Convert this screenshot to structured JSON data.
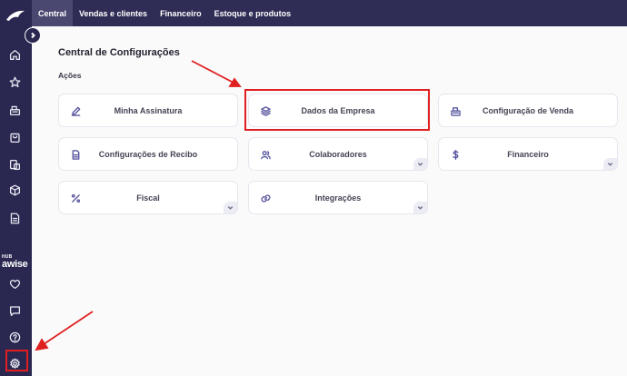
{
  "nav": {
    "tabs": [
      {
        "label": "Central",
        "active": true
      },
      {
        "label": "Vendas e clientes",
        "active": false
      },
      {
        "label": "Financeiro",
        "active": false
      },
      {
        "label": "Estoque e produtos",
        "active": false
      }
    ]
  },
  "sidebar": {
    "icons": [
      "home-icon",
      "star-icon",
      "cash-register-icon",
      "bag-icon",
      "documents-icon",
      "box-icon",
      "file-icon",
      "heart-icon",
      "chat-icon",
      "help-icon",
      "gear-icon"
    ],
    "brand_small": "HUB",
    "brand_big": "awise"
  },
  "main": {
    "title": "Central de Configurações",
    "section": "Ações",
    "cards": [
      {
        "label": "Minha Assinatura",
        "icon": "pencil-icon"
      },
      {
        "label": "Dados da Empresa",
        "icon": "layers-icon"
      },
      {
        "label": "Configuração de Venda",
        "icon": "register-icon"
      },
      {
        "label": "Configurações de Recibo",
        "icon": "receipt-icon"
      },
      {
        "label": "Colaboradores",
        "icon": "users-icon"
      },
      {
        "label": "Financeiro",
        "icon": "dollar-icon"
      },
      {
        "label": "Fiscal",
        "icon": "percent-icon"
      },
      {
        "label": "Integrações",
        "icon": "link-icon"
      }
    ]
  },
  "colors": {
    "sidebar": "#2a2850",
    "topnav": "#2f2d55",
    "active_tab": "#4a4870",
    "annotation": "#e02020"
  }
}
